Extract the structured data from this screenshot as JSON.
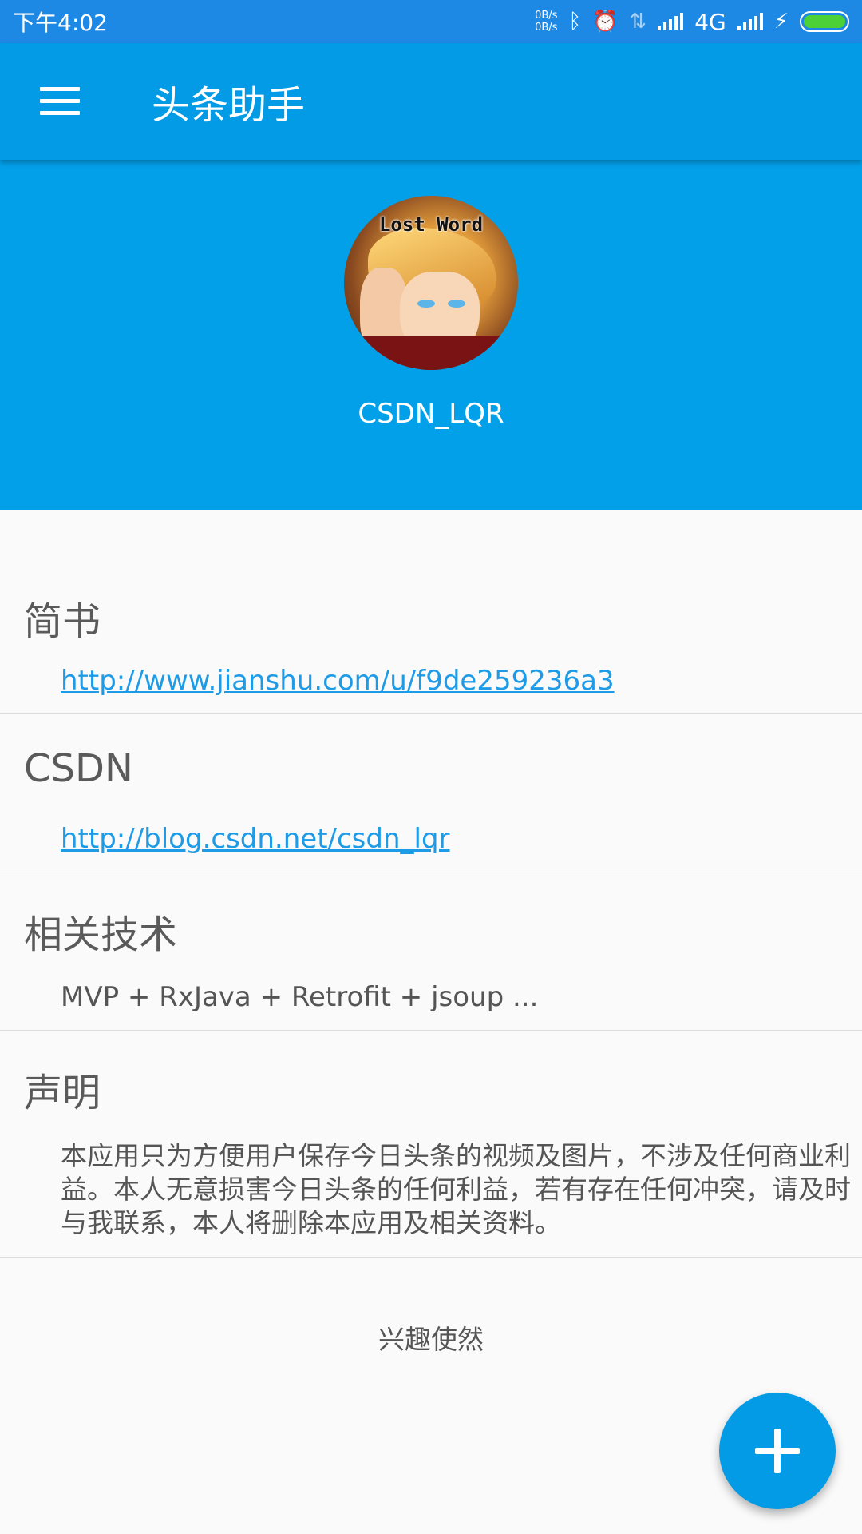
{
  "status_bar": {
    "time": "下午4:02",
    "net_up": "0B/s",
    "net_down": "0B/s",
    "network": "4G",
    "icons": [
      "bluetooth-icon",
      "alarm-icon",
      "data-transfer-icon",
      "signal-icon",
      "signal-icon-2",
      "charging-icon",
      "battery-icon"
    ]
  },
  "toolbar": {
    "title": "头条助手",
    "menu_icon": "hamburger-menu-icon"
  },
  "profile": {
    "avatar_text": "Lost Word",
    "username": "CSDN_LQR"
  },
  "sections": [
    {
      "heading": "简书",
      "content": "http://www.jianshu.com/u/f9de259236a3",
      "type": "link"
    },
    {
      "heading": "CSDN",
      "content": "http://blog.csdn.net/csdn_lqr",
      "type": "link"
    },
    {
      "heading": "相关技术",
      "content": "MVP + RxJava + Retrofit + jsoup ...",
      "type": "text"
    },
    {
      "heading": "声明",
      "content": "本应用只为方便用户保存今日头条的视频及图片，不涉及任何商业利益。本人无意损害今日头条的任何利益，若有存在任何冲突，请及时与我联系，本人将删除本应用及相关资料。",
      "type": "text"
    }
  ],
  "footer": "兴趣使然",
  "fab": {
    "icon": "plus-icon"
  },
  "colors": {
    "status_bar": "#1e88e5",
    "toolbar": "#039be5",
    "header": "#03a0ea",
    "link": "#1e9be6",
    "fab": "#039be5"
  }
}
